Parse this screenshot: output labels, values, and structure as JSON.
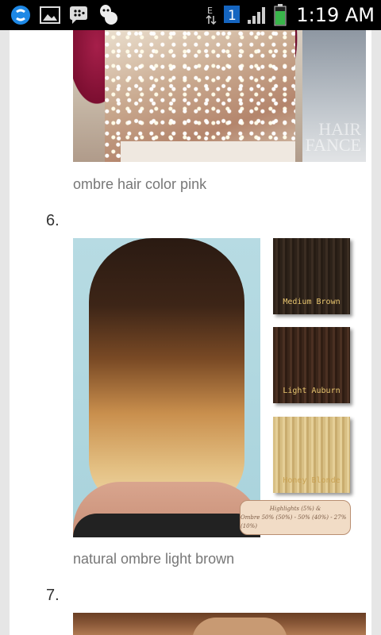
{
  "statusbar": {
    "time": "1:19 AM",
    "notification_count": "1",
    "network": "E",
    "icons": [
      "sync-icon",
      "gallery-icon",
      "bbm-icon",
      "app-icon"
    ],
    "battery_color": "#39b54a",
    "accent": "#33b5e5"
  },
  "article": {
    "items": [
      {
        "caption": "ombre hair color pink"
      },
      {
        "number": "6.",
        "caption": "natural ombre light brown",
        "swatches": [
          "Medium Brown",
          "Light Auburn",
          "Honey Blonde"
        ],
        "note_line1": "Highlights (5%) &",
        "note_line2": "Ombre 50% (50%) - 50% (40%) - 27% (10%)"
      },
      {
        "number": "7."
      }
    ],
    "watermark_line1": "HAIR",
    "watermark_line2": "FANCE"
  }
}
